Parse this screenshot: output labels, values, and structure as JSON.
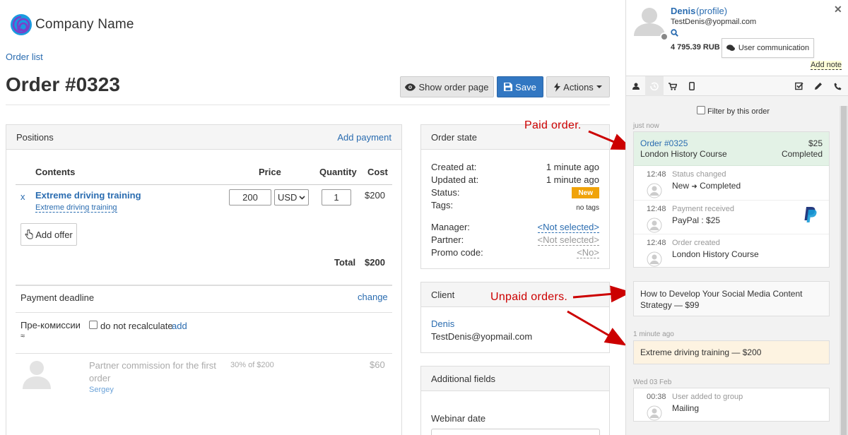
{
  "brand": {
    "name": "Company Name"
  },
  "breadcrumb": {
    "order_list": "Order list"
  },
  "page": {
    "title": "Order #0323"
  },
  "toolbar": {
    "show_order_page": "Show order page",
    "save": "Save",
    "actions": "Actions"
  },
  "positions": {
    "title": "Positions",
    "add_payment": "Add payment",
    "headers": {
      "contents": "Contents",
      "price": "Price",
      "quantity": "Quantity",
      "cost": "Cost"
    },
    "item": {
      "remove": "x",
      "name": "Extreme driving training",
      "sub": "Extreme driving training",
      "price": "200",
      "currency": "USD",
      "quantity": "1",
      "cost": "$200"
    },
    "add_offer": "Add offer",
    "total_label": "Total",
    "total_value": "$200",
    "deadline_label": "Payment deadline",
    "deadline_change": "change",
    "commission_label": "Пре-комиссии",
    "commission_sub": "≈",
    "no_recalc": "do not recalculate",
    "add": "add",
    "partner_text": "Partner commission for the first order",
    "partner_name": "Sergey",
    "partner_pct": "30% of $200",
    "partner_amount": "$60"
  },
  "order_state": {
    "title": "Order state",
    "created_label": "Created at:",
    "created_value": "1 minute ago",
    "updated_label": "Updated at:",
    "updated_value": "1 minute ago",
    "status_label": "Status:",
    "status_value": "New",
    "tags_label": "Tags:",
    "tags_value": "no tags",
    "manager_label": "Manager:",
    "manager_value": "<Not selected>",
    "partner_label": "Partner:",
    "partner_value": "<Not selected>",
    "promo_label": "Promo code:",
    "promo_value": "<No>"
  },
  "client": {
    "title": "Client",
    "name": "Denis",
    "email": "TestDenis@yopmail.com"
  },
  "additional": {
    "title": "Additional fields",
    "webinar_label": "Webinar date"
  },
  "user_panel": {
    "name": "Denis",
    "profile": "(profile)",
    "email": "TestDenis@yopmail.com",
    "balance": "4 795.39 RUB",
    "communication": "User communication",
    "add_note": "Add note",
    "filter": "Filter by this order",
    "group1_time": "just now",
    "paid_order": {
      "title": "Order #0325",
      "amount": "$25",
      "course": "London History Course",
      "status": "Completed"
    },
    "events": [
      {
        "time": "12:48",
        "label": "Status changed",
        "value_from": "New",
        "value_to": "Completed"
      },
      {
        "time": "12:48",
        "label": "Payment received",
        "value": "PayPal : $25"
      },
      {
        "time": "12:48",
        "label": "Order created",
        "value": "London History Course"
      }
    ],
    "unpaid1": "How to Develop Your Social Media Content Strategy — $99",
    "group2_time": "1 minute ago",
    "unpaid2": "Extreme driving training — $200",
    "group3_time": "Wed 03 Feb",
    "event_group": {
      "time": "00:38",
      "label": "User added to group",
      "value": "Mailing"
    }
  },
  "annotations": {
    "paid": "Paid order.",
    "unpaid": "Unpaid orders."
  },
  "colors": {
    "accent": "#2a6cb0",
    "save": "#3277c2",
    "badge_new": "#f0a30a",
    "paid_bg": "#e3f2e6",
    "unpaid_bg": "#fdf3e1",
    "annotation": "#c00000"
  }
}
